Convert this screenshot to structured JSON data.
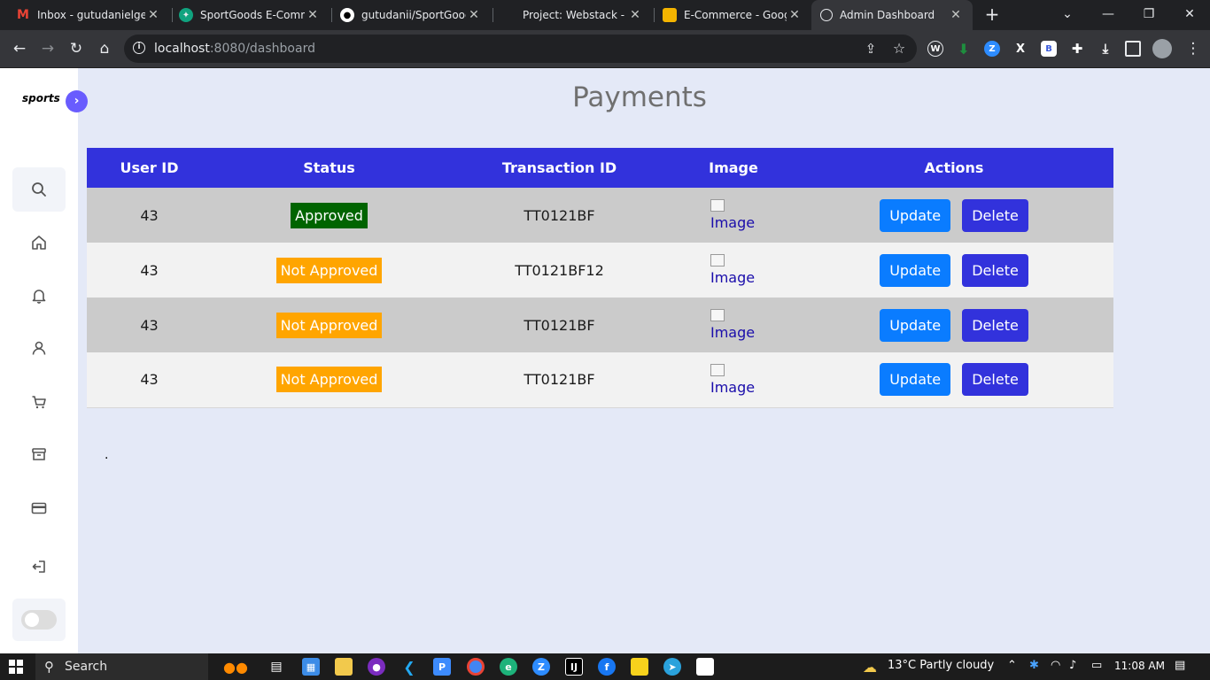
{
  "browser": {
    "tabs": [
      {
        "title": "Inbox - gutudanielgele",
        "icon": "gmail-icon"
      },
      {
        "title": "SportGoods E-Comme",
        "icon": "chatgpt-icon"
      },
      {
        "title": "gutudanii/SportGoods",
        "icon": "github-icon"
      },
      {
        "title": "Project: Webstack - Po",
        "icon": "page-icon"
      },
      {
        "title": "E-Commerce - Google",
        "icon": "slides-icon"
      },
      {
        "title": "Admin Dashboard",
        "icon": "globe-icon"
      }
    ],
    "url_host": "localhost",
    "url_path": ":8080/dashboard"
  },
  "sidebar": {
    "logo": "sports",
    "items": [
      {
        "name": "home",
        "icon": "home-icon"
      },
      {
        "name": "notifications",
        "icon": "bell-icon"
      },
      {
        "name": "users",
        "icon": "user-icon"
      },
      {
        "name": "cart",
        "icon": "cart-icon"
      },
      {
        "name": "products",
        "icon": "archive-icon"
      },
      {
        "name": "payments",
        "icon": "credit-card-icon"
      },
      {
        "name": "logout",
        "icon": "logout-icon"
      }
    ]
  },
  "main": {
    "title": "Payments",
    "columns": [
      "User ID",
      "Status",
      "Transaction ID",
      "Image",
      "Actions"
    ],
    "rows": [
      {
        "user_id": "43",
        "status": "Approved",
        "status_type": "approved",
        "transaction_id": "TT0121BF",
        "image_alt": "Image"
      },
      {
        "user_id": "43",
        "status": "Not Approved",
        "status_type": "not",
        "transaction_id": "TT0121BF12",
        "image_alt": "Image"
      },
      {
        "user_id": "43",
        "status": "Not Approved",
        "status_type": "not",
        "transaction_id": "TT0121BF",
        "image_alt": "Image"
      },
      {
        "user_id": "43",
        "status": "Not Approved",
        "status_type": "not",
        "transaction_id": "TT0121BF",
        "image_alt": "Image"
      }
    ],
    "update_label": "Update",
    "delete_label": "Delete",
    "footer_mark": "."
  },
  "taskbar": {
    "search_label": "Search",
    "weather": "13°C  Partly cloudy",
    "time": "11:08 AM"
  },
  "colors": {
    "accent": "#3232dc",
    "update": "#0a7cff",
    "approved": "#006400",
    "not_approved": "#ffa500",
    "sidebar_toggle": "#695cfe"
  }
}
